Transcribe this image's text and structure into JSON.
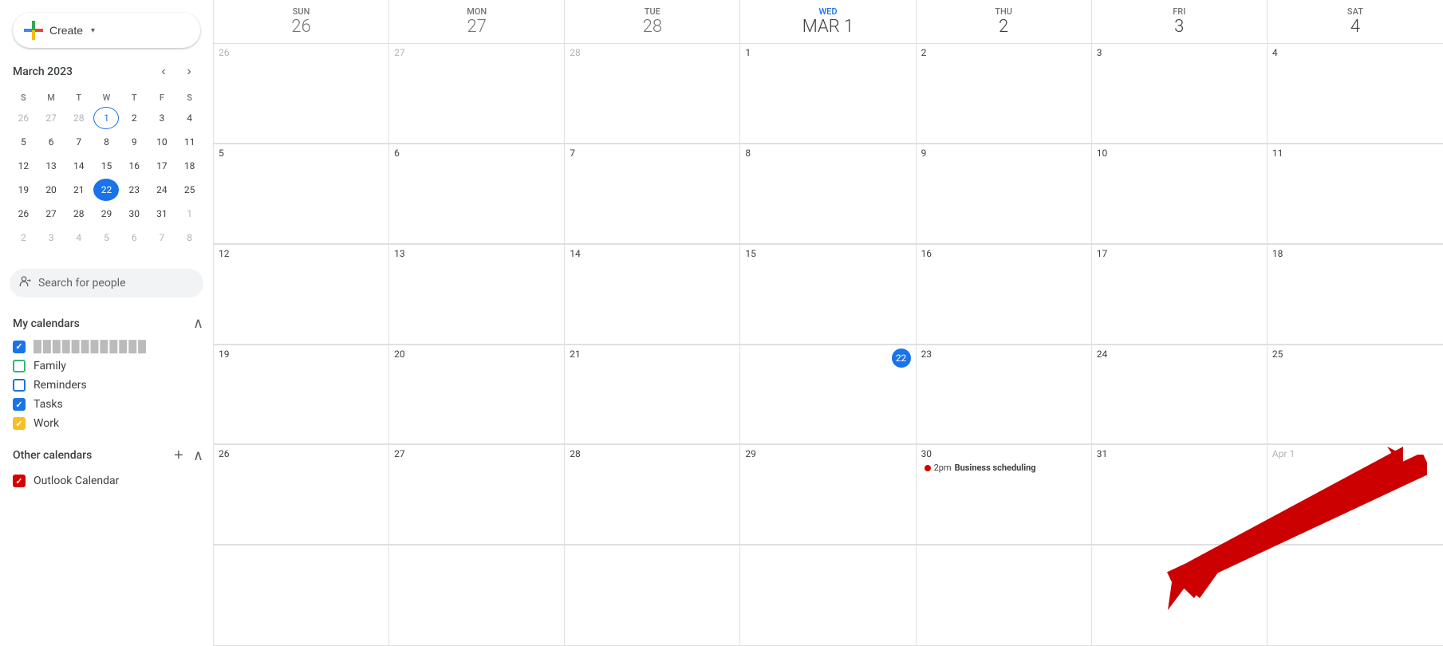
{
  "sidebar": {
    "create_label": "Create",
    "mini_cal": {
      "title": "March 2023",
      "days_of_week": [
        "S",
        "M",
        "T",
        "W",
        "T",
        "F",
        "S"
      ],
      "weeks": [
        [
          {
            "d": 26,
            "other": true
          },
          {
            "d": 27,
            "other": true
          },
          {
            "d": 28,
            "other": true
          },
          {
            "d": 1,
            "today_outline": true
          },
          {
            "d": 2
          },
          {
            "d": 3
          },
          {
            "d": 4
          }
        ],
        [
          {
            "d": 5
          },
          {
            "d": 6
          },
          {
            "d": 7
          },
          {
            "d": 8
          },
          {
            "d": 9
          },
          {
            "d": 10
          },
          {
            "d": 11
          }
        ],
        [
          {
            "d": 12
          },
          {
            "d": 13
          },
          {
            "d": 14
          },
          {
            "d": 15
          },
          {
            "d": 16
          },
          {
            "d": 17
          },
          {
            "d": 18
          }
        ],
        [
          {
            "d": 19
          },
          {
            "d": 20
          },
          {
            "d": 21
          },
          {
            "d": 22,
            "selected": true
          },
          {
            "d": 23
          },
          {
            "d": 24
          },
          {
            "d": 25
          }
        ],
        [
          {
            "d": 26
          },
          {
            "d": 27
          },
          {
            "d": 28
          },
          {
            "d": 29
          },
          {
            "d": 30
          },
          {
            "d": 31
          },
          {
            "d": 1,
            "other": true
          }
        ],
        [
          {
            "d": 2,
            "other": true
          },
          {
            "d": 3,
            "other": true
          },
          {
            "d": 4,
            "other": true
          },
          {
            "d": 5,
            "other": true
          },
          {
            "d": 6,
            "other": true
          },
          {
            "d": 7,
            "other": true
          },
          {
            "d": 8,
            "other": true
          }
        ]
      ]
    },
    "search_people_placeholder": "Search for people",
    "my_calendars_label": "My calendars",
    "calendars": [
      {
        "label": "████████████",
        "blurred": true,
        "checked": true,
        "color": "blue"
      },
      {
        "label": "Family",
        "checked": false,
        "color": "green"
      },
      {
        "label": "Reminders",
        "checked": false,
        "color": "blue-outline"
      },
      {
        "label": "Tasks",
        "checked": true,
        "color": "blue"
      },
      {
        "label": "Work",
        "checked": true,
        "color": "orange"
      }
    ],
    "other_calendars_label": "Other calendars",
    "other_calendars": [
      {
        "label": "Outlook Calendar",
        "checked": true,
        "color": "red"
      }
    ]
  },
  "main_calendar": {
    "days_of_week": [
      "SUN",
      "MON",
      "TUE",
      "WED",
      "THU",
      "FRI",
      "SAT"
    ],
    "week_rows": [
      {
        "dates": [
          26,
          27,
          28,
          "Mar 1",
          2,
          3,
          4
        ],
        "today_index": 3
      }
    ],
    "grid": [
      {
        "week": [
          26,
          27,
          28,
          "1",
          2,
          3,
          4
        ],
        "today_col": -1,
        "muted_cols": [
          0,
          1,
          2
        ]
      },
      {
        "week": [
          5,
          6,
          7,
          8,
          9,
          10,
          11
        ],
        "today_col": -1
      },
      {
        "week": [
          12,
          13,
          14,
          15,
          16,
          17,
          18
        ],
        "today_col": -1
      },
      {
        "week": [
          19,
          20,
          21,
          22,
          23,
          24,
          25
        ],
        "today_col": 3
      },
      {
        "week": [
          26,
          27,
          28,
          29,
          30,
          31,
          "Apr 1"
        ],
        "today_col": -1,
        "events": [
          {
            "col": 4,
            "time": "2pm",
            "label": "Business scheduling",
            "color": "#d50000"
          }
        ]
      },
      {
        "week": [],
        "empty": true
      }
    ],
    "header_days": [
      {
        "dow": "SUN",
        "num": "26",
        "muted": true
      },
      {
        "dow": "MON",
        "num": "27",
        "muted": true
      },
      {
        "dow": "TUE",
        "num": "28",
        "muted": true
      },
      {
        "dow": "WED",
        "num": "Mar 1",
        "muted": false
      },
      {
        "dow": "THU",
        "num": "2",
        "muted": false
      },
      {
        "dow": "FRI",
        "num": "3",
        "muted": false
      },
      {
        "dow": "SAT",
        "num": "4",
        "muted": false
      }
    ]
  },
  "colors": {
    "blue": "#1a73e8",
    "green": "#33b679",
    "orange": "#f6bf26",
    "red": "#d50000",
    "today_bg": "#1a73e8"
  }
}
